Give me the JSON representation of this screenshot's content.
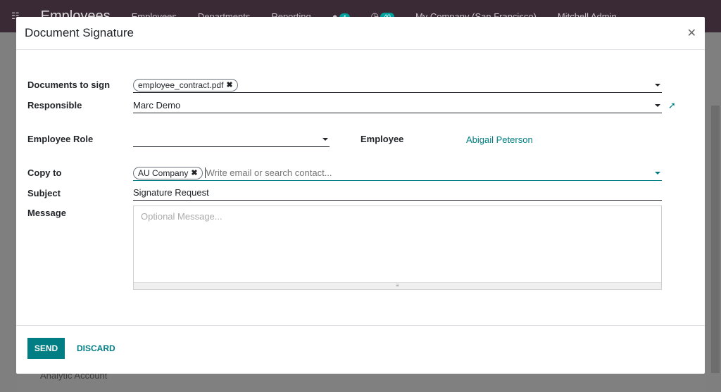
{
  "topbar": {
    "app": "Employees",
    "menu": [
      "Employees",
      "Departments",
      "Reporting"
    ],
    "chat_count": "4",
    "activity_count": "40",
    "company": "My Company (San Francisco)",
    "user": "Mitchell Admin"
  },
  "background": {
    "label": "Analytic Account"
  },
  "modal": {
    "title": "Document Signature",
    "fields": {
      "documents_label": "Documents to sign",
      "documents_tags": [
        "employee_contract.pdf"
      ],
      "responsible_label": "Responsible",
      "responsible_value": "Marc Demo",
      "role_label": "Employee Role",
      "role_value": "",
      "employee_label": "Employee",
      "employee_value": "Abigail Peterson",
      "copy_label": "Copy to",
      "copy_tags": [
        "AU Company"
      ],
      "copy_placeholder": "Write email or search contact...",
      "subject_label": "Subject",
      "subject_value": "Signature Request",
      "message_label": "Message",
      "message_placeholder": "Optional Message..."
    },
    "footer": {
      "send": "SEND",
      "discard": "DISCARD"
    }
  },
  "colors": {
    "accent": "#017e84",
    "navbar": "#3a2a36"
  }
}
